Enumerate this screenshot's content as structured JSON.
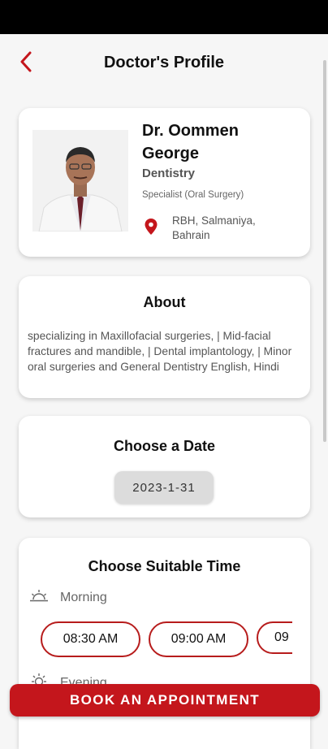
{
  "header": {
    "title": "Doctor's Profile",
    "back_icon": "chevron-left-icon"
  },
  "profile": {
    "name": "Dr. Oommen George",
    "specialty": "Dentistry",
    "subtitle": "Specialist (Oral Surgery)",
    "location": "RBH, Salmaniya, Bahrain",
    "location_icon": "map-pin-icon"
  },
  "about": {
    "title": "About",
    "text": "specializing in Maxillofacial surgeries, | Mid-facial fractures and mandible, | Dental implantology, | Minor oral surgeries and General Dentistry English, Hindi"
  },
  "date": {
    "title": "Choose a Date",
    "selected": "2023-1-31"
  },
  "time": {
    "title": "Choose Suitable Time",
    "morning_label": "Morning",
    "evening_label": "Evening",
    "morning_slots": [
      "08:30 AM",
      "09:00 AM",
      "09"
    ]
  },
  "cta": {
    "label": "BOOK AN APPOINTMENT"
  },
  "colors": {
    "accent": "#c4161c",
    "background": "#f6f6f6"
  }
}
